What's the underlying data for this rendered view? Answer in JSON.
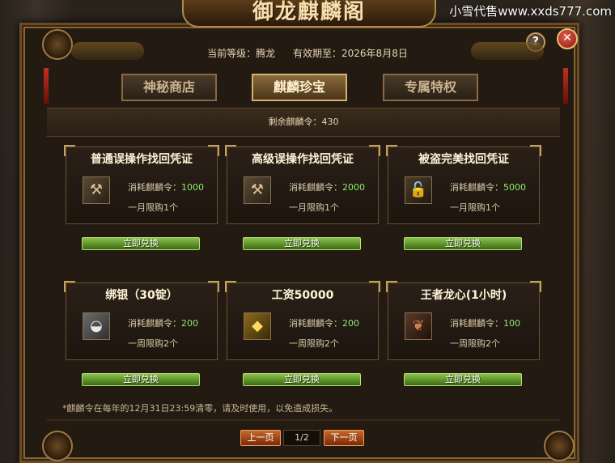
{
  "watermark": "小雪代售www.xxds777.com",
  "window": {
    "title": "御龙麒麟阁",
    "help_glyph": "?",
    "close_glyph": "✕"
  },
  "status": {
    "level_label": "当前等级：腾龙",
    "expiry_label": "有效期至：2026年8月8日"
  },
  "tabs": [
    {
      "label": "神秘商店",
      "active": false
    },
    {
      "label": "麒麟珍宝",
      "active": true
    },
    {
      "label": "专属特权",
      "active": false
    }
  ],
  "balance": "剩余麒麟令：430",
  "cost_prefix": "消耗麒麟令：",
  "items": [
    {
      "title": "普通误操作找回凭证",
      "icon": "wrench-icon",
      "cost": "1000",
      "limit": "一月限购1个",
      "button": "立即兑换"
    },
    {
      "title": "高级误操作找回凭证",
      "icon": "wrench-icon",
      "cost": "2000",
      "limit": "一月限购1个",
      "button": "立即兑换"
    },
    {
      "title": "被盗完美找回凭证",
      "icon": "lock-icon",
      "cost": "5000",
      "limit": "一月限购1个",
      "button": "立即兑换"
    },
    {
      "title": "绑银（30锭）",
      "icon": "silver-ingot-icon",
      "cost": "200",
      "limit": "一周限购2个",
      "button": "立即兑换"
    },
    {
      "title": "工资50000",
      "icon": "gold-ingot-icon",
      "cost": "200",
      "limit": "一周限购2个",
      "button": "立即兑换"
    },
    {
      "title": "王者龙心(1小时)",
      "icon": "dragon-heart-icon",
      "cost": "100",
      "limit": "一周限购2个",
      "button": "立即兑换"
    }
  ],
  "footnote": "*麒麟令在每年的12月31日23:59清零，请及时使用，以免造成损失。",
  "pager": {
    "prev": "上一页",
    "page": "1/2",
    "next": "下一页"
  }
}
